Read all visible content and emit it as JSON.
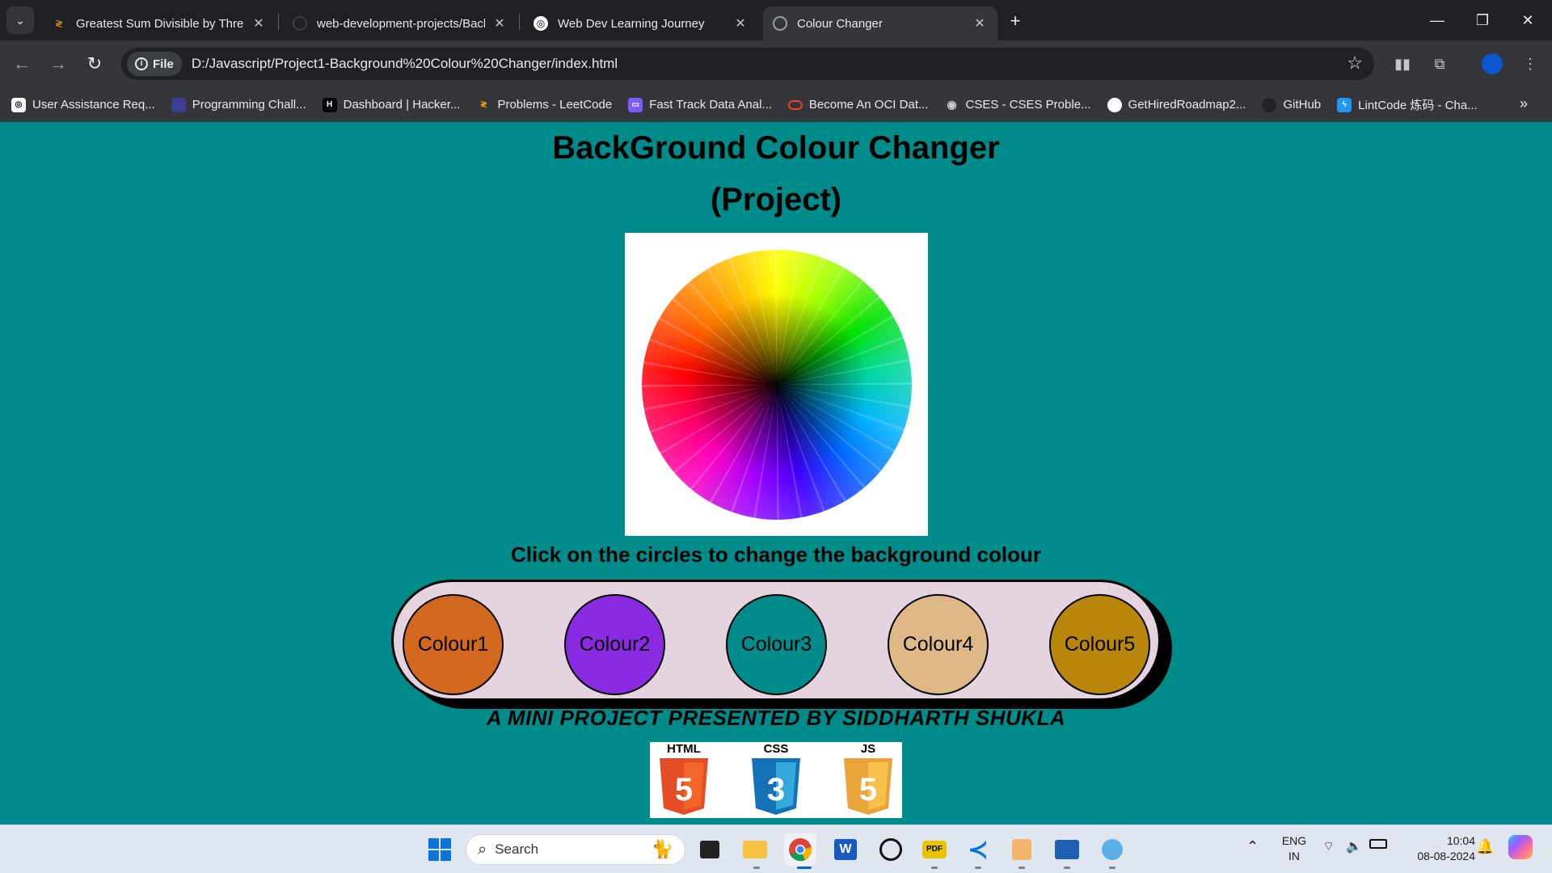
{
  "browser": {
    "tabs": [
      {
        "title": "Greatest Sum Divisible by Three",
        "active": false
      },
      {
        "title": "web-development-projects/Background",
        "active": false
      },
      {
        "title": "Web Dev Learning Journey",
        "active": false
      },
      {
        "title": "Colour Changer",
        "active": true
      }
    ],
    "address": {
      "chip_label": "File",
      "url": "D:/Javascript/Project1-Background%20Colour%20Changer/index.html"
    },
    "bookmarks": [
      {
        "label": "User Assistance Req...",
        "icon": "openai-icon",
        "color": "#ffffff"
      },
      {
        "label": "Programming Chall...",
        "icon": "codingame-icon",
        "color": "#3b3f8f"
      },
      {
        "label": "Dashboard | Hacker...",
        "icon": "hackerrank-icon",
        "color": "#1ba94c"
      },
      {
        "label": "Problems - LeetCode",
        "icon": "leetcode-icon",
        "color": "#ffa116"
      },
      {
        "label": "Fast Track Data Anal...",
        "icon": "course-icon",
        "color": "#7b5cff"
      },
      {
        "label": "Become An OCI Dat...",
        "icon": "oracle-icon",
        "color": "#f03e2f"
      },
      {
        "label": "CSES - CSES Proble...",
        "icon": "cses-icon",
        "color": "#cccccc"
      },
      {
        "label": "GetHiredRoadmap2...",
        "icon": "github-icon",
        "color": "#ffffff"
      },
      {
        "label": "GitHub",
        "icon": "github-icon",
        "color": "#222222"
      },
      {
        "label": "LintCode 炼码 - Cha...",
        "icon": "lintcode-icon",
        "color": "#2196f3"
      }
    ]
  },
  "page": {
    "title_line1": "BackGround Colour Changer",
    "title_line2": "(Project)",
    "instruction": "Click on the circles to change the background colour",
    "background_color": "#008b8b",
    "circles": [
      {
        "label": "Colour1",
        "color": "#d2691e"
      },
      {
        "label": "Colour2",
        "color": "#8a2be2"
      },
      {
        "label": "Colour3",
        "color": "#008b8b"
      },
      {
        "label": "Colour4",
        "color": "#deb887"
      },
      {
        "label": "Colour5",
        "color": "#b8860b"
      }
    ],
    "credit": "A MINI PROJECT PRESENTED BY SIDDHARTH SHUKLA",
    "logos": [
      {
        "label": "HTML",
        "digit": "5",
        "color": "#e44d26"
      },
      {
        "label": "CSS",
        "digit": "3",
        "color": "#1572b6"
      },
      {
        "label": "JS",
        "digit": "5",
        "color": "#f0a830"
      }
    ]
  },
  "taskbar": {
    "search_placeholder": "Search",
    "language_line1": "ENG",
    "language_line2": "IN",
    "time": "10:04",
    "date": "08-08-2024"
  }
}
